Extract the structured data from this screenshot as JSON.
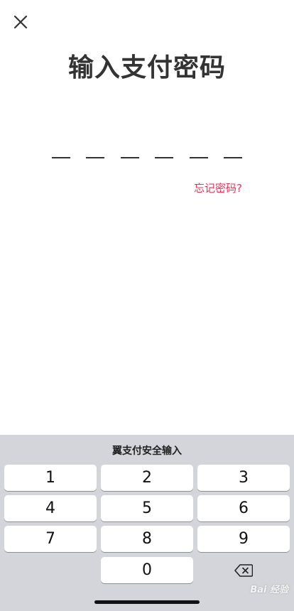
{
  "header": {
    "close_icon": "close-icon",
    "title": "输入支付密码"
  },
  "pin": {
    "length": 6,
    "entered": 0
  },
  "forgot_link": "忘记密码?",
  "keyboard": {
    "title": "翼支付安全输入",
    "keys": [
      "1",
      "2",
      "3",
      "4",
      "5",
      "6",
      "7",
      "8",
      "9",
      "0"
    ],
    "delete_icon": "backspace-icon"
  },
  "watermark": "Bai 经验"
}
